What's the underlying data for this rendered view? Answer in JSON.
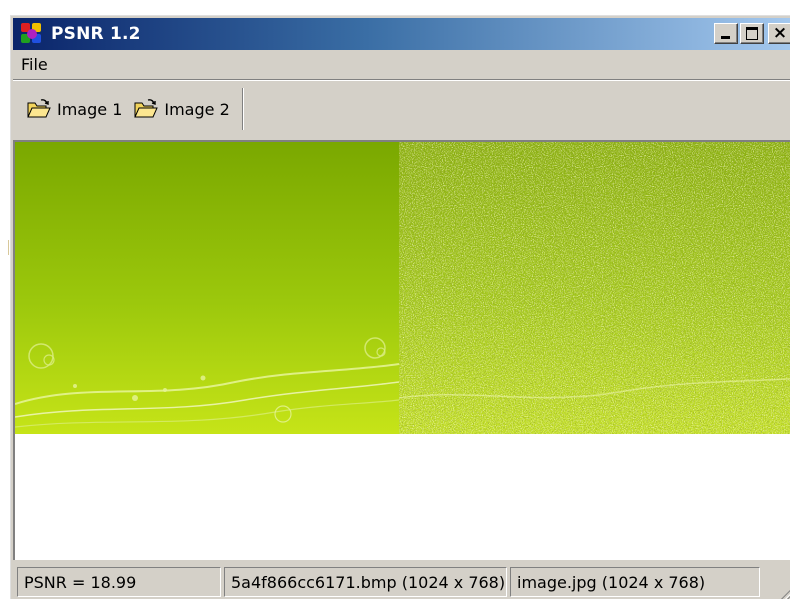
{
  "window": {
    "title": "PSNR 1.2",
    "controls": {
      "minimize": "_",
      "maximize": "□",
      "close": "×"
    }
  },
  "menu": {
    "items": [
      "File"
    ]
  },
  "toolbar": {
    "buttons": [
      {
        "label": "Image 1",
        "icon": "open-folder-icon"
      },
      {
        "label": "Image 2",
        "icon": "open-folder-icon"
      }
    ]
  },
  "status": {
    "psnr": "PSNR = 18.99",
    "image1": "5a4f866cc6171.bmp (1024 x 768)",
    "image2": "image.jpg (1024 x 768)"
  },
  "colors": {
    "title_gradient_start": "#0a246a",
    "title_gradient_end": "#a6caf0",
    "image_green_dark": "#7aa800",
    "image_green_light": "#c6e418"
  }
}
